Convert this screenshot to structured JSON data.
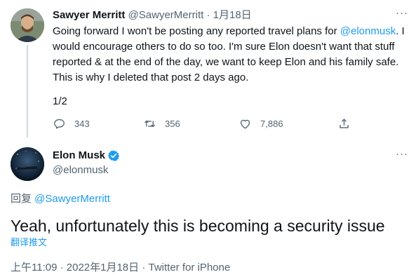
{
  "tweet1": {
    "author_name": "Sawyer Merritt",
    "author_handle": "@SawyerMerritt",
    "separator": "·",
    "date": "1月18日",
    "text_lead": "Going forward I won't be posting any reported travel plans for ",
    "mention": "@elonmusk",
    "text_rest": ". I would encourage others to do so too. I'm sure Elon doesn't want that stuff reported & at the end of the day, we want to keep Elon and his family safe. This is why I deleted that post 2 days ago.",
    "thread_count": "1/2",
    "more_icon": "···",
    "actions": {
      "reply_count": "343",
      "retweet_count": "356",
      "like_count": "7,886"
    }
  },
  "tweet2": {
    "author_name": "Elon Musk",
    "author_handle": "@elonmusk",
    "more_icon": "···",
    "reply_prefix": "回复 ",
    "reply_mention": "@SawyerMerritt",
    "text": "Yeah, unfortunately this is becoming a security issue",
    "translate_label": "翻译推文",
    "meta": "上午11:09 · 2022年1月18日 · Twitter for iPhone"
  },
  "colors": {
    "accent": "#1d9bf0",
    "text": "#0f1419",
    "secondary": "#536471"
  }
}
